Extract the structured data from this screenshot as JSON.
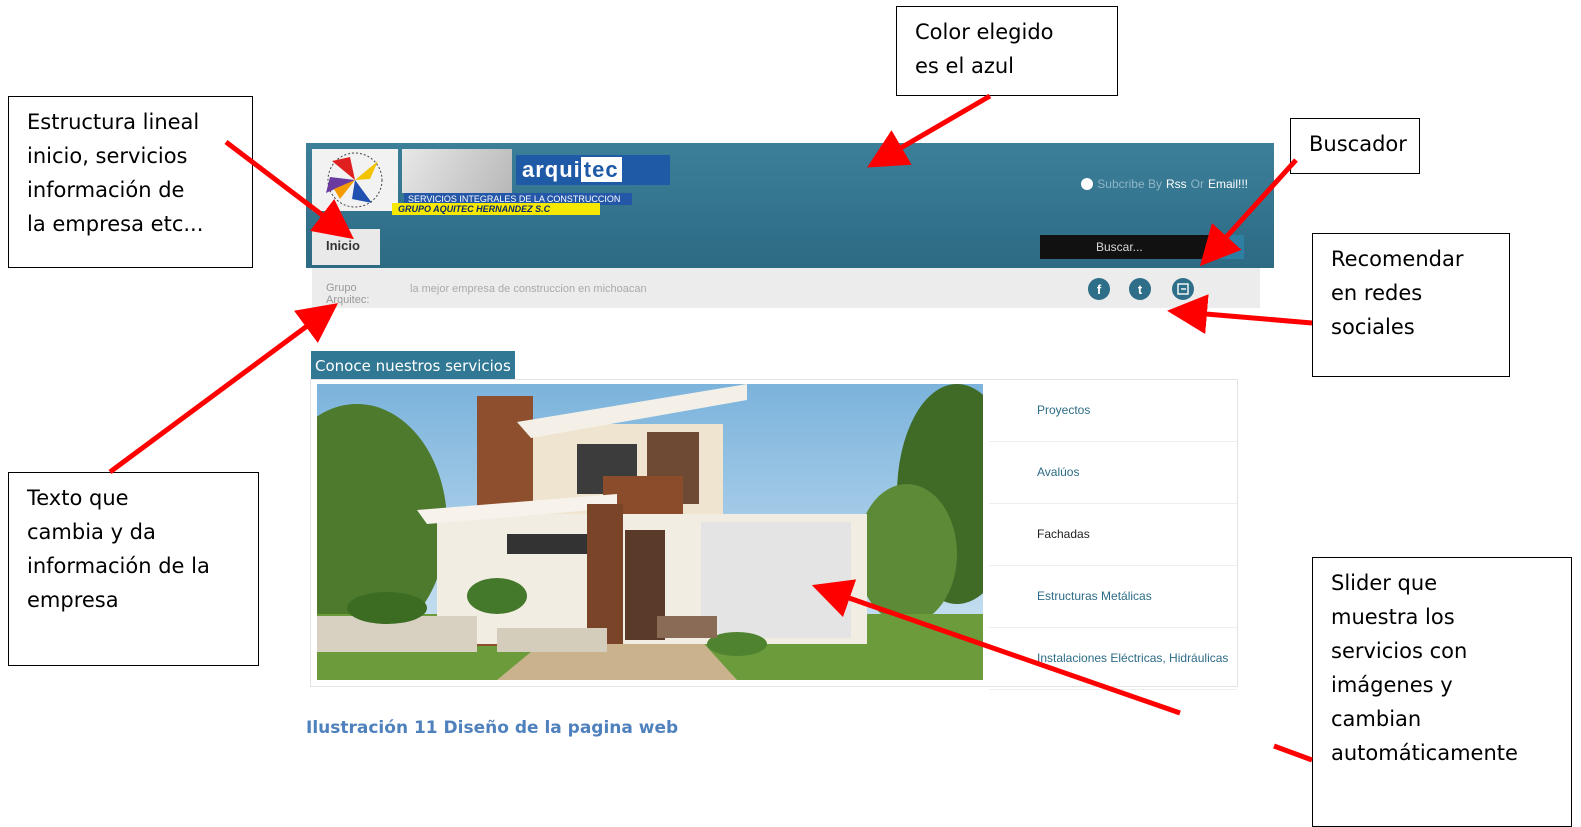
{
  "callouts": {
    "color": "Color elegido\nes el azul",
    "estructura": "Estructura lineal\ninicio, servicios\ninformación de\nla empresa etc...",
    "buscador": "Buscador",
    "recomendar": "Recomendar\nen redes\nsociales",
    "texto": "Texto que\ncambia y da\ninformación de la\nempresa",
    "slider": "Slider que\nmuestra los\nservicios con\nimágenes y\ncambian\nautomáticamente"
  },
  "website": {
    "logo": {
      "brand_a": "arqui",
      "brand_b": "tec",
      "subtitle": "SERVICIOS INTEGRALES DE LA CONSTRUCCION",
      "group": "GRUPO AQUITEC HERNANDEZ S.C"
    },
    "subscribe": {
      "part1": "Subcribe By",
      "rss": "Rss",
      "or": "Or",
      "email": "Email!!!"
    },
    "nav": {
      "home": "Inicio"
    },
    "search": {
      "placeholder": "Buscar..."
    },
    "info": {
      "label_line1": "Grupo",
      "label_line2": "Arquitec:",
      "text": "la mejor empresa de construccion en michoacan"
    },
    "social_icons": [
      "facebook-icon",
      "twitter-icon",
      "share-icon"
    ],
    "services_title": "Conoce nuestros servicios",
    "services": [
      "Proyectos",
      "Avalúos",
      "Fachadas",
      "Estructuras Metálicas",
      "Instalaciones Eléctricas, Hidráulicas"
    ],
    "active_service_index": 2
  },
  "caption": "Ilustración 11 Diseño de la pagina web",
  "colors": {
    "header": "#2d6a84",
    "accent": "#317894",
    "arrow": "#ff0000",
    "caption": "#4f81bd"
  }
}
